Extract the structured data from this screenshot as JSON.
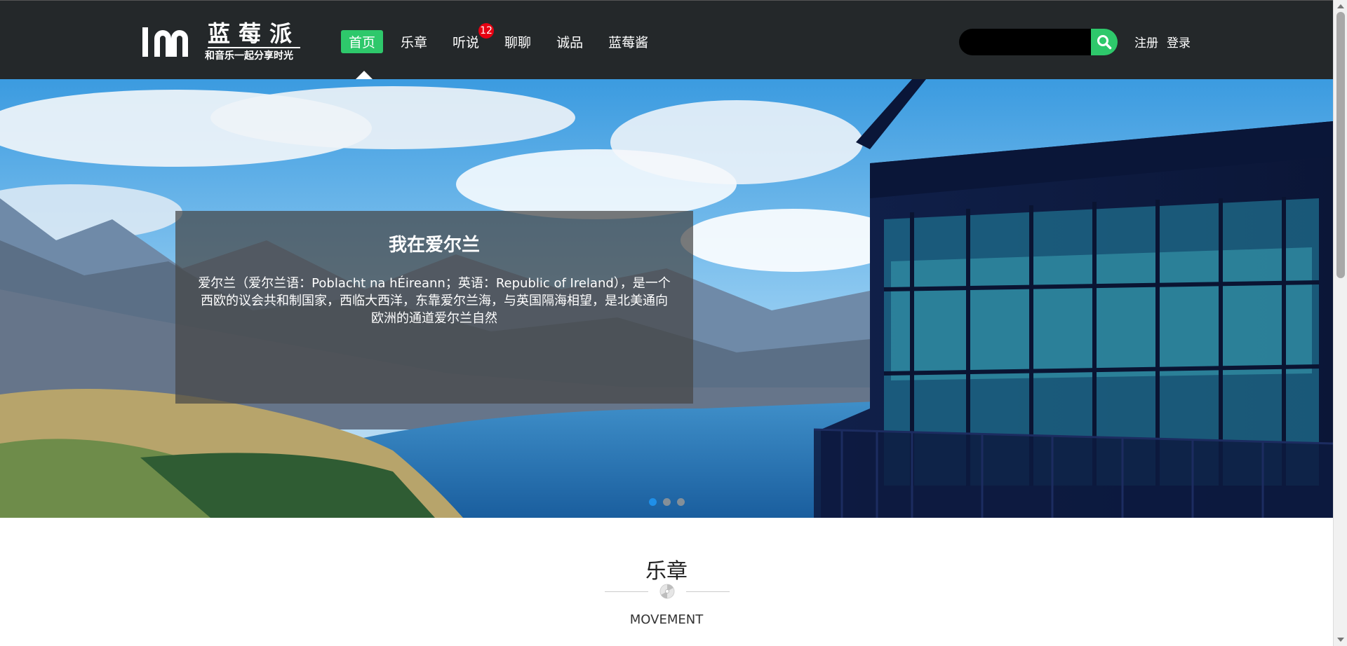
{
  "header": {
    "logo_title": "蓝莓派",
    "logo_subtitle": "和音乐一起分享时光",
    "nav": [
      {
        "label": "首页",
        "active": true
      },
      {
        "label": "乐章"
      },
      {
        "label": "听说",
        "badge": "12"
      },
      {
        "label": "聊聊"
      },
      {
        "label": "诚品"
      },
      {
        "label": "蓝莓酱"
      }
    ],
    "search": {
      "placeholder": "",
      "value": ""
    },
    "register_label": "注册",
    "login_label": "登录"
  },
  "banner": {
    "caption_title": "我在爱尔兰",
    "caption_text": "爱尔兰（爱尔兰语：Poblacht na hÉireann；英语：Republic of Ireland），是一个西欧的议会共和制国家，西临大西洋，东靠爱尔兰海，与英国隔海相望，是北美通向欧洲的通道爱尔兰自然",
    "slide_count": 3,
    "active_slide": 1
  },
  "section": {
    "title": "乐章",
    "subtitle": "MOVEMENT"
  },
  "colors": {
    "header_bg": "#24282a",
    "accent_green": "#2ec86b",
    "badge_red": "#e60012",
    "dot_active": "#1f8fe8"
  },
  "icons": {
    "search": "search-icon",
    "divider": "disc-icon"
  }
}
